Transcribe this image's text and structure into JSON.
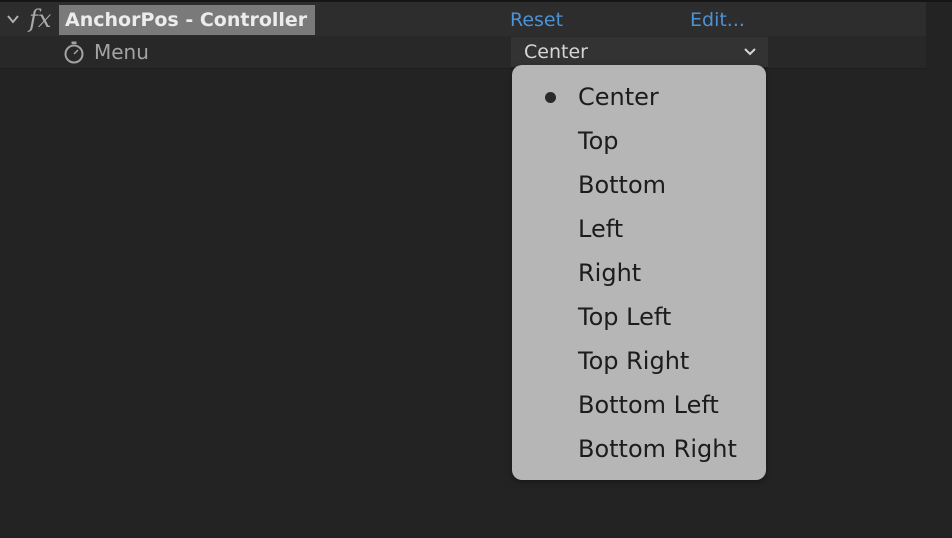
{
  "effect": {
    "name": "AnchorPos - Controller",
    "fx_glyph": "fx",
    "reset_label": "Reset",
    "edit_label": "Edit..."
  },
  "parameter": {
    "label": "Menu",
    "selected_value": "Center"
  },
  "menu": {
    "items": [
      {
        "label": "Center",
        "selected": true
      },
      {
        "label": "Top",
        "selected": false
      },
      {
        "label": "Bottom",
        "selected": false
      },
      {
        "label": "Left",
        "selected": false
      },
      {
        "label": "Right",
        "selected": false
      },
      {
        "label": "Top Left",
        "selected": false
      },
      {
        "label": "Top Right",
        "selected": false
      },
      {
        "label": "Bottom Left",
        "selected": false
      },
      {
        "label": "Bottom Right",
        "selected": false
      }
    ]
  },
  "icons": {
    "twirl": "chevron-down-icon",
    "stopwatch": "stopwatch-icon",
    "dropdown": "chevron-down-icon",
    "selected_marker": "bullet-icon"
  },
  "colors": {
    "background": "#232323",
    "link": "#4c92d6",
    "menu_background": "#b6b6b6",
    "effect_name_highlight": "#7a7a7a"
  }
}
